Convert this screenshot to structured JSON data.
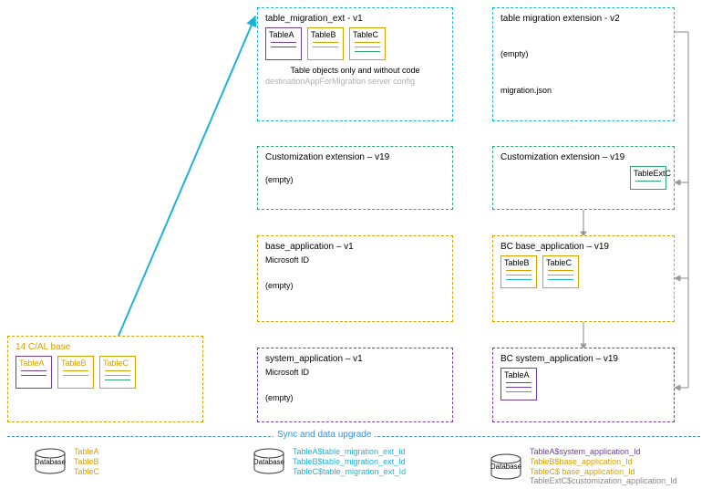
{
  "sync_label": "Sync and data upgrade",
  "col1": {
    "cal_base": {
      "title": "14 C/AL base",
      "tables": [
        {
          "name": "TableA",
          "color": "#6f3fa0",
          "lines": [
            "#6f3fa0",
            "#6f3fa0"
          ]
        },
        {
          "name": "TableB",
          "color": "#d6a100",
          "lines": [
            "#d6a100",
            "#d6a100"
          ]
        },
        {
          "name": "TableC",
          "color": "#d6a100",
          "lines": [
            "#d6a100",
            "#d6a100",
            "#2fa86f"
          ]
        }
      ]
    },
    "db": {
      "label": "Database",
      "lines": [
        {
          "text": "TableA",
          "color": "#d6a100"
        },
        {
          "text": "TableB",
          "color": "#d6a100"
        },
        {
          "text": "TableC",
          "color": "#d6a100"
        }
      ]
    }
  },
  "col2": {
    "migration_ext": {
      "title": "table_migration_ext - v1",
      "caption": "Table objects only and without code",
      "footer": "destinationAppForMigration server config",
      "tables": [
        {
          "name": "TableA",
          "color": "#6f3fa0",
          "lines": [
            "#6f3fa0",
            "#6f3fa0"
          ]
        },
        {
          "name": "TableB",
          "color": "#d6a100",
          "lines": [
            "#d6a100",
            "#d6a100"
          ]
        },
        {
          "name": "TableC",
          "color": "#d6a100",
          "lines": [
            "#d6a100",
            "#d6a100",
            "#2fa86f"
          ]
        }
      ]
    },
    "customization": {
      "title": "Customization extension – v19",
      "body": "(empty)"
    },
    "base_app": {
      "title": "base_application – v1",
      "sub": "Microsoft ID",
      "body": "(empty)"
    },
    "sys_app": {
      "title": "system_application – v1",
      "sub": "Microsoft ID",
      "body": "(empty)"
    },
    "db": {
      "label": "Database",
      "lines": [
        {
          "text": "TableA$table_migration_ext_Id",
          "color": "#1db4d4"
        },
        {
          "text": "TableB$table_migration_ext_Id",
          "color": "#1db4d4"
        },
        {
          "text": "TableC$table_migration_ext_Id",
          "color": "#1db4d4"
        }
      ]
    }
  },
  "col3": {
    "migration_ext_v2": {
      "title": "table migration extension - v2",
      "body": "(empty)",
      "footer": "migration.json"
    },
    "customization": {
      "title": "Customization extension – v19",
      "tables": [
        {
          "name": "TableExtC",
          "color": "#2fa86f",
          "lines": [
            "#2fa86f"
          ]
        }
      ]
    },
    "base_app": {
      "title": "BC base_application – v19",
      "tables": [
        {
          "name": "TableB",
          "color": "#d6a100",
          "lines": [
            "#d6a100",
            "#d6a100",
            "#1db4d4"
          ]
        },
        {
          "name": "TableC",
          "color": "#d6a100",
          "lines": [
            "#d6a100",
            "#d6a100",
            "#1db4d4"
          ]
        }
      ]
    },
    "sys_app": {
      "title": "BC system_application – v19",
      "tables": [
        {
          "name": "TableA",
          "color": "#6f3fa0",
          "lines": [
            "#6f3fa0",
            "#6f3fa0",
            "#1db4d4"
          ]
        }
      ]
    },
    "db": {
      "label": "Database",
      "lines": [
        {
          "text": "TableA$system_application_Id",
          "color": "#6f3fa0"
        },
        {
          "text": "TableB$base_application_Id",
          "color": "#d6a100"
        },
        {
          "text": "TableC$ base_application_Id",
          "color": "#d6a100"
        },
        {
          "text": "TableExtC$customization_application_Id",
          "color": "#888"
        }
      ]
    }
  }
}
